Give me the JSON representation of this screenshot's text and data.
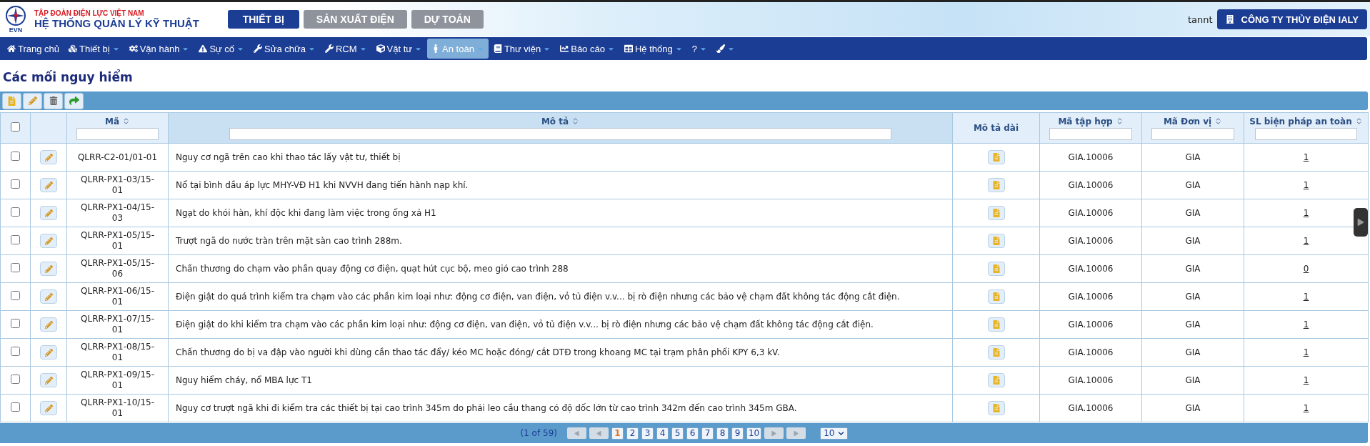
{
  "header": {
    "logo_caption": "EVN",
    "org": "TẬP ĐOÀN ĐIỆN LỰC VIỆT NAM",
    "system": "HỆ THỐNG QUẢN LÝ KỸ THUẬT",
    "modules": [
      {
        "label": "THIẾT BỊ",
        "selected": true
      },
      {
        "label": "SẢN XUẤT ĐIỆN",
        "selected": false
      },
      {
        "label": "DỰ TOÁN",
        "selected": false
      }
    ],
    "user": "tannt",
    "company": "CÔNG TY THỦY ĐIỆN IALY"
  },
  "menu": [
    {
      "label": "Trang chủ",
      "dropdown": false,
      "selected": false
    },
    {
      "label": "Thiết bị",
      "dropdown": true,
      "selected": false
    },
    {
      "label": "Vận hành",
      "dropdown": true,
      "selected": false
    },
    {
      "label": "Sự cố",
      "dropdown": true,
      "selected": false
    },
    {
      "label": "Sửa chữa",
      "dropdown": true,
      "selected": false
    },
    {
      "label": "RCM",
      "dropdown": true,
      "selected": false
    },
    {
      "label": "Vật tư",
      "dropdown": true,
      "selected": false
    },
    {
      "label": "An toàn",
      "dropdown": true,
      "selected": true
    },
    {
      "label": "Thư viện",
      "dropdown": true,
      "selected": false
    },
    {
      "label": "Báo cáo",
      "dropdown": true,
      "selected": false
    },
    {
      "label": "Hệ thống",
      "dropdown": true,
      "selected": false
    },
    {
      "label": "?",
      "dropdown": true,
      "selected": false
    },
    {
      "dropdown": true,
      "selected": false
    }
  ],
  "page_title": "Các mối nguy hiểm",
  "table": {
    "select_all_checked": false,
    "columns": [
      {
        "label": "Mã",
        "sortable": true,
        "filter": true,
        "sorted": false
      },
      {
        "label": "Mô tả",
        "sortable": true,
        "filter": true,
        "sorted": true
      },
      {
        "label": "Mô tả dài",
        "sortable": false,
        "filter": false,
        "sorted": false
      },
      {
        "label": "Mã tập hợp",
        "sortable": true,
        "filter": true,
        "sorted": false
      },
      {
        "label": "Mã Đơn vị",
        "sortable": true,
        "filter": true,
        "sorted": false
      },
      {
        "label": "SL biện pháp an toàn",
        "sortable": true,
        "filter": true,
        "sorted": false
      }
    ],
    "rows": [
      {
        "checked": false,
        "code": "QLRR-C2-01/01-01",
        "description": "Nguy cơ ngã trên cao khi thao tác lấy vật tư, thiết bị",
        "set_code": "GIA.10006",
        "unit": "GIA",
        "measures": "1"
      },
      {
        "checked": false,
        "code": "QLRR-PX1-03/15-01",
        "description": "Nổ tại bình dầu áp lực MHY-VĐ H1 khi NVVH đang tiến hành nạp khí.",
        "set_code": "GIA.10006",
        "unit": "GIA",
        "measures": "1"
      },
      {
        "checked": false,
        "code": "QLRR-PX1-04/15-03",
        "description": "Ngạt do khói hàn, khí độc khi đang làm việc trong ống xả H1",
        "set_code": "GIA.10006",
        "unit": "GIA",
        "measures": "1"
      },
      {
        "checked": false,
        "code": "QLRR-PX1-05/15-01",
        "description": "Trượt ngã do nước tràn trên mặt sàn cao trình 288m.",
        "set_code": "GIA.10006",
        "unit": "GIA",
        "measures": "1"
      },
      {
        "checked": false,
        "code": "QLRR-PX1-05/15-06",
        "description": "Chấn thương do chạm vào phần quay động cơ điện, quạt hút cục bộ, meo gió cao trình 288",
        "set_code": "GIA.10006",
        "unit": "GIA",
        "measures": "0"
      },
      {
        "checked": false,
        "code": "QLRR-PX1-06/15-01",
        "description": "Điện giật do quá trình kiểm tra chạm vào các phần kim loại như: động cơ điện, van điện, vỏ tủ điện v.v... bị rò điện nhưng các bảo vệ chạm đất không tác động cắt điện.",
        "set_code": "GIA.10006",
        "unit": "GIA",
        "measures": "1"
      },
      {
        "checked": false,
        "code": "QLRR-PX1-07/15-01",
        "description": "Điện giật do khi kiểm tra chạm vào các phần kim loại như: động cơ điện, van điện, vỏ tủ điện v.v... bị rò điện nhưng các bảo vệ chạm đất không tác động cắt điện.",
        "set_code": "GIA.10006",
        "unit": "GIA",
        "measures": "1"
      },
      {
        "checked": false,
        "code": "QLRR-PX1-08/15-01",
        "description": "Chấn thương do bị va đập vào người khi dùng cần thao tác đẩy/ kéo MC hoặc đóng/ cắt DTĐ trong khoang MC tại trạm phân phối KPY 6,3 kV.",
        "set_code": "GIA.10006",
        "unit": "GIA",
        "measures": "1"
      },
      {
        "checked": false,
        "code": "QLRR-PX1-09/15-01",
        "description": "Nguy hiểm cháy, nổ MBA lực T1",
        "set_code": "GIA.10006",
        "unit": "GIA",
        "measures": "1"
      },
      {
        "checked": false,
        "code": "QLRR-PX1-10/15-01",
        "description": "Nguy cơ trượt ngã khi đi kiểm tra các thiết bị tại cao trình 345m do phải leo cầu thang có độ dốc lớn từ cao trình 342m đến cao trình 345m GBA.",
        "set_code": "GIA.10006",
        "unit": "GIA",
        "measures": "1"
      }
    ]
  },
  "pagination": {
    "summary": "(1 of 59)",
    "pages": [
      {
        "label": "1",
        "selected": true
      },
      {
        "label": "2",
        "selected": false
      },
      {
        "label": "3",
        "selected": false
      },
      {
        "label": "4",
        "selected": false
      },
      {
        "label": "5",
        "selected": false
      },
      {
        "label": "6",
        "selected": false
      },
      {
        "label": "7",
        "selected": false
      },
      {
        "label": "8",
        "selected": false
      },
      {
        "label": "9",
        "selected": false
      },
      {
        "label": "10",
        "selected": false
      }
    ],
    "page_size": "10"
  }
}
